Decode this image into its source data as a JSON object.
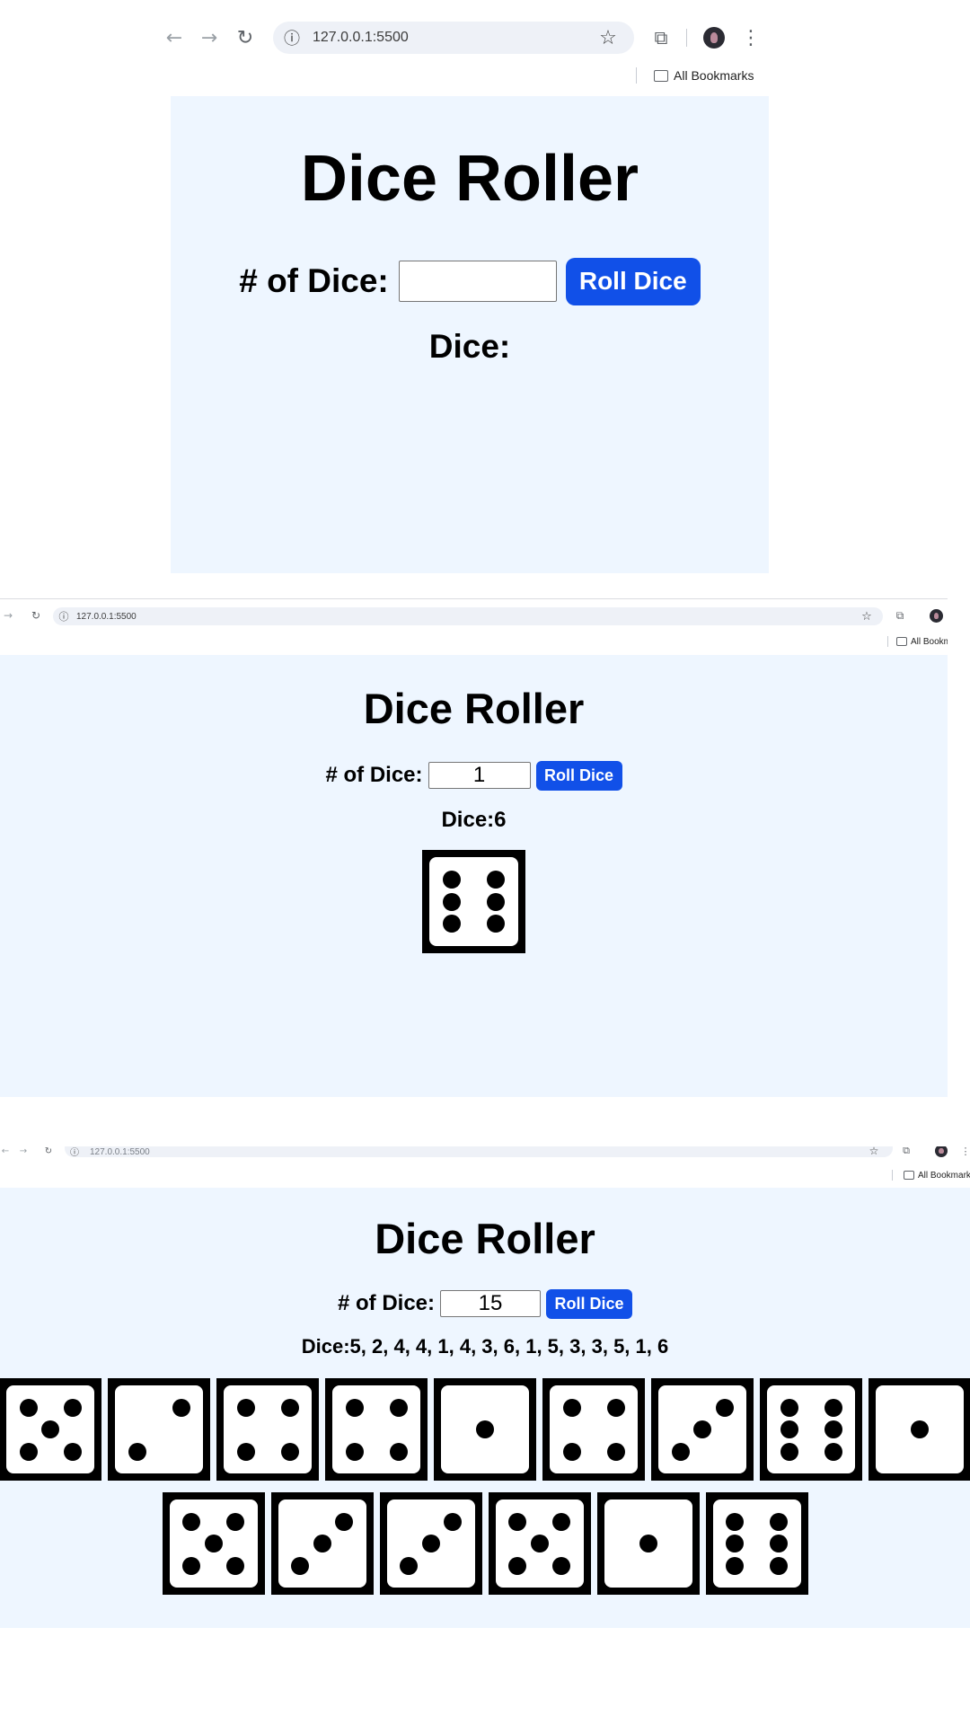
{
  "browser": {
    "url": "127.0.0.1:5500",
    "bookmarks_label": "All Bookmarks",
    "bookmarks_label_cut": "All Bookm"
  },
  "app": {
    "title": "Dice Roller",
    "input_label": "# of Dice:",
    "button_label": "Roll Dice",
    "result_label": "Dice:"
  },
  "states": [
    {
      "input_value": "",
      "result_values": "",
      "dice": []
    },
    {
      "input_value": "1",
      "result_values": "6",
      "dice": [
        6
      ]
    },
    {
      "input_value": "15",
      "result_values": "5, 2, 4, 4, 1, 4, 3, 6, 1, 5, 3, 3, 5, 1, 6",
      "dice": [
        5,
        2,
        4,
        4,
        1,
        4,
        3,
        6,
        1,
        5,
        3,
        3,
        5,
        1,
        6
      ]
    }
  ],
  "colors": {
    "page_bg": "#eef6ff",
    "button_bg": "#1150e8",
    "button_text": "#ffffff",
    "omnibox_bg": "#eef1f7"
  },
  "icons": [
    "back-arrow-icon",
    "forward-arrow-icon",
    "reload-icon",
    "site-info-icon",
    "bookmark-star-icon",
    "extensions-icon",
    "profile-avatar",
    "more-menu-icon",
    "bookmarks-folder-icon"
  ]
}
